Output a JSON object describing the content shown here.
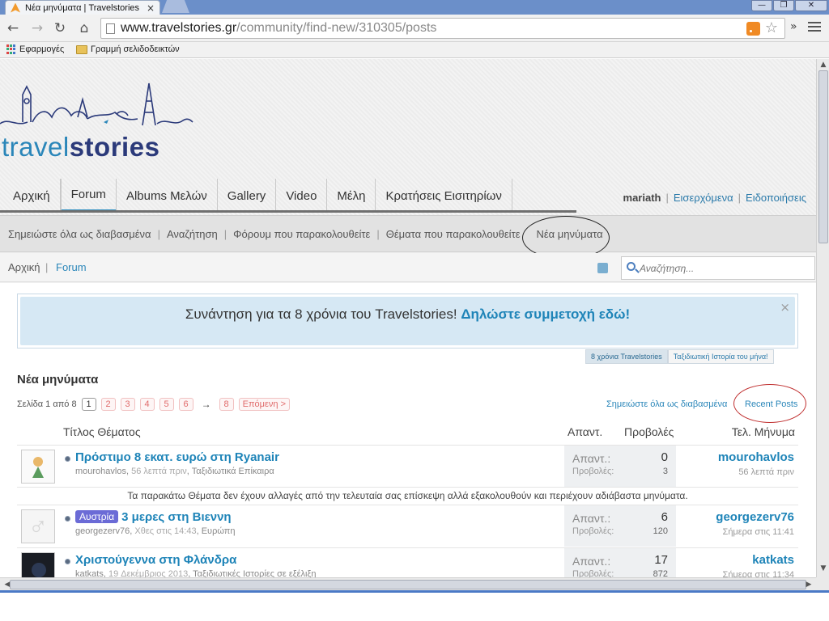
{
  "browser": {
    "tab_title": "Νέα μηνύματα | Travelstories",
    "tab_close": "×",
    "window_buttons": [
      "—",
      "❐",
      "✕"
    ],
    "url_host": "www.travelstories.gr",
    "url_path": "/community/find-new/310305/posts",
    "back": "←",
    "forward": "→",
    "reload": "↻",
    "home": "⌂",
    "star": "☆",
    "more": "»",
    "bookmarks": [
      {
        "label": "Εφαρμογές",
        "icon": "apps-icon"
      },
      {
        "label": "Γραμμή σελιδοδεικτών",
        "icon": "folder-icon"
      }
    ]
  },
  "site": {
    "logo_part1": "travel",
    "logo_part2": "stories",
    "nav_tabs": [
      "Αρχική",
      "Forum",
      "Albums Μελών",
      "Gallery",
      "Video",
      "Μέλη",
      "Κρατήσεις Εισιτηρίων"
    ],
    "active_tab": "Forum",
    "user": {
      "name": "mariath",
      "links": [
        "Εισερχόμενα",
        "Ειδοποιήσεις"
      ]
    },
    "subnav": [
      "Σημειώστε όλα ως διαβασμένα",
      "Αναζήτηση",
      "Φόρουμ που παρακολουθείτε",
      "Θέματα που παρακολουθείτε"
    ],
    "subnav_highlight": "Νέα μηνύματα",
    "breadcrumb": [
      "Αρχική",
      "Forum"
    ],
    "search_placeholder": "Αναζήτηση..."
  },
  "notice": {
    "text": "Συνάντηση για τα 8 χρόνια του Travelstories!",
    "link": "Δηλώστε συμμετοχή εδώ!",
    "close": "×",
    "tabs": [
      "8 χρόνια Travelstories",
      "Ταξιδιωτική Ιστορία του μήνα!"
    ]
  },
  "page": {
    "title": "Νέα μηνύματα",
    "pager": {
      "label": "Σελίδα 1 από 8",
      "pages": [
        "1",
        "2",
        "3",
        "4",
        "5",
        "6"
      ],
      "arrow": "→",
      "last": "8",
      "next": "Επόμενη >"
    },
    "mark_read": "Σημειώστε όλα ως διαβασμένα",
    "recent_posts": "Recent Posts",
    "columns": [
      "Τίτλος Θέματος",
      "Απαντ.",
      "Προβολές",
      "Τελ. Μήνυμα"
    ],
    "stat_labels": {
      "replies": "Απαντ.:",
      "views": "Προβολές:"
    },
    "unread_note": "Τα παρακάτω Θέματα δεν έχουν αλλαγές από την τελευταία σας επίσκεψη αλλά εξακολουθούν και περιέχουν αδιάβαστα μηνύματα.",
    "threads": [
      {
        "prefix": "",
        "title": "Πρόστιμο 8 εκατ. ευρώ στη Ryanair",
        "author": "mourohavlos",
        "time": "56 λεπτά πριν",
        "forum": "Ταξιδιωτικά Επίκαιρα",
        "replies": "0",
        "views": "3",
        "last_user": "mourohavlos",
        "last_time": "56 λεπτά πριν",
        "avatar": "prince"
      },
      {
        "prefix": "Αυστρία",
        "title": "3 μερες στη Βιεννη",
        "author": "georgezerv76",
        "time": "Χθες στις 14:43",
        "forum": "Ευρώπη",
        "replies": "6",
        "views": "120",
        "last_user": "georgezerv76",
        "last_time": "Σήμερα στις 11:41",
        "avatar": "male"
      },
      {
        "prefix": "",
        "title": "Χριστούγεννα στη Φλάνδρα",
        "author": "katkats",
        "time": "19 Δεκέμβριος 2013",
        "forum": "Ταξιδιωτικές Ιστορίες σε εξέλιξη",
        "replies": "17",
        "views": "872",
        "last_user": "katkats",
        "last_time": "Σήμερα στις 11:34",
        "avatar": "cat"
      }
    ]
  },
  "colors": {
    "accent": "#1e84b8",
    "active_tab_underline": "#3190c2",
    "notice_bg": "#d6e8f4",
    "prefix_bg": "#6b6bd6",
    "highlight_circle_black": "#222222",
    "highlight_circle_red": "#c03030"
  }
}
